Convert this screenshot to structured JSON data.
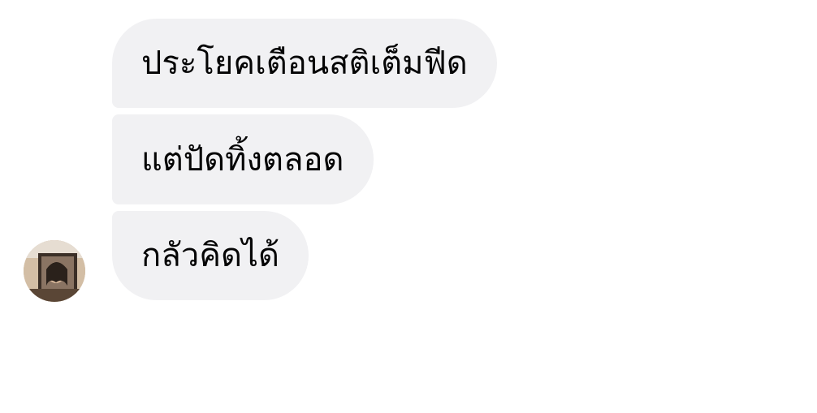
{
  "messages": [
    {
      "text": "ประโยคเตือนสติเต็มฟีด"
    },
    {
      "text": "แต่ปัดทิ้งตลอด"
    },
    {
      "text": "กลัวคิดได้"
    }
  ],
  "colors": {
    "bubble_background": "#f1f1f3",
    "text": "#050505",
    "page_background": "#ffffff"
  },
  "avatar": {
    "icon": "sender-avatar"
  }
}
